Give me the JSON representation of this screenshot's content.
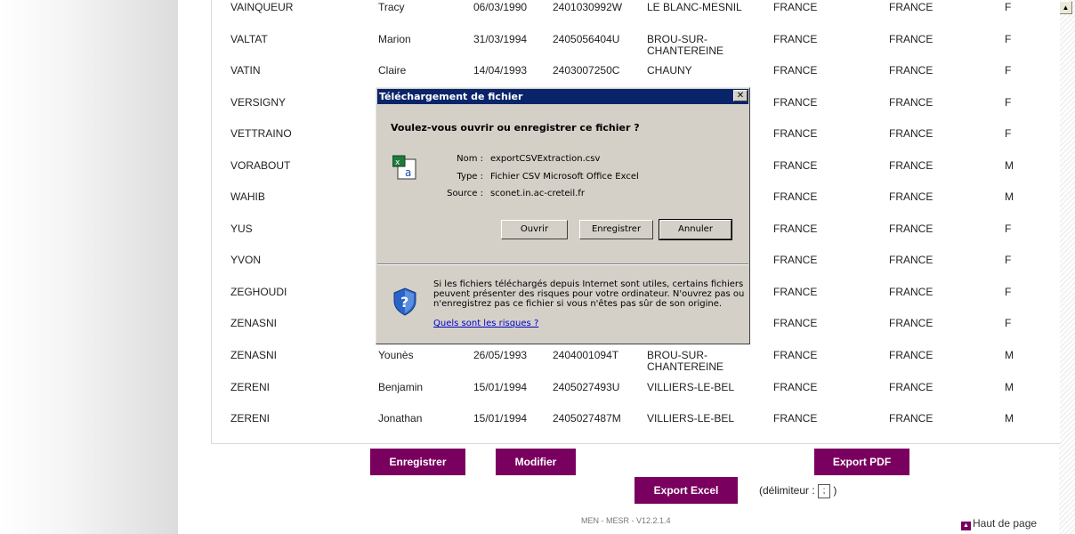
{
  "table": {
    "rows": [
      {
        "name": "VAINQUEUR",
        "first": "Tracy",
        "dob": "06/03/1990",
        "ine": "2401030992W",
        "city": "LE BLANC-MESNIL",
        "country1": "FRANCE",
        "country2": "FRANCE",
        "sex": "F"
      },
      {
        "name": "VALTAT",
        "first": "Marion",
        "dob": "31/03/1994",
        "ine": "2405056404U",
        "city": "BROU-SUR-CHANTEREINE",
        "country1": "FRANCE",
        "country2": "FRANCE",
        "sex": "F"
      },
      {
        "name": "VATIN",
        "first": "Claire",
        "dob": "14/04/1993",
        "ine": "2403007250C",
        "city": "CHAUNY",
        "country1": "FRANCE",
        "country2": "FRANCE",
        "sex": "F"
      },
      {
        "name": "VERSIGNY",
        "first": "",
        "dob": "",
        "ine": "",
        "city": "",
        "country1": "FRANCE",
        "country2": "FRANCE",
        "sex": "F"
      },
      {
        "name": "VETTRAINO",
        "first": "",
        "dob": "",
        "ine": "",
        "city": "",
        "country1": "FRANCE",
        "country2": "FRANCE",
        "sex": "F"
      },
      {
        "name": "VORABOUT",
        "first": "",
        "dob": "",
        "ine": "",
        "city": "",
        "country1": "FRANCE",
        "country2": "FRANCE",
        "sex": "M"
      },
      {
        "name": "WAHIB",
        "first": "",
        "dob": "",
        "ine": "",
        "city": "",
        "country1": "FRANCE",
        "country2": "FRANCE",
        "sex": "M"
      },
      {
        "name": "YUS",
        "first": "",
        "dob": "",
        "ine": "",
        "city": "",
        "country1": "FRANCE",
        "country2": "FRANCE",
        "sex": "F"
      },
      {
        "name": "YVON",
        "first": "",
        "dob": "",
        "ine": "",
        "city": "",
        "country1": "FRANCE",
        "country2": "FRANCE",
        "sex": "F"
      },
      {
        "name": "ZEGHOUDI",
        "first": "",
        "dob": "",
        "ine": "",
        "city": "",
        "country1": "FRANCE",
        "country2": "FRANCE",
        "sex": "F"
      },
      {
        "name": "ZENASNI",
        "first": "",
        "dob": "",
        "ine": "",
        "city": "",
        "country1": "FRANCE",
        "country2": "FRANCE",
        "sex": "F"
      },
      {
        "name": "ZENASNI",
        "first": "Younès",
        "dob": "26/05/1993",
        "ine": "2404001094T",
        "city": "BROU-SUR-CHANTEREINE",
        "country1": "FRANCE",
        "country2": "FRANCE",
        "sex": "M"
      },
      {
        "name": "ZERENI",
        "first": "Benjamin",
        "dob": "15/01/1994",
        "ine": "2405027493U",
        "city": "VILLIERS-LE-BEL",
        "country1": "FRANCE",
        "country2": "FRANCE",
        "sex": "M"
      },
      {
        "name": "ZERENI",
        "first": "Jonathan",
        "dob": "15/01/1994",
        "ine": "2405027487M",
        "city": "VILLIERS-LE-BEL",
        "country1": "FRANCE",
        "country2": "FRANCE",
        "sex": "M"
      }
    ]
  },
  "actions": {
    "save": "Enregistrer",
    "modify": "Modifier",
    "export_pdf": "Export PDF",
    "export_excel": "Export Excel",
    "delimiter_label": "(délimiteur :",
    "delimiter_value": ";",
    "delimiter_close": ")"
  },
  "footer": {
    "version": "MEN - MESR - V12.2.1.4",
    "top_link": "Haut de page"
  },
  "dialog": {
    "title": "Téléchargement de fichier",
    "question": "Voulez-vous ouvrir ou enregistrer ce fichier ?",
    "name_label": "Nom :",
    "name_value": "exportCSVExtraction.csv",
    "type_label": "Type :",
    "type_value": "Fichier CSV Microsoft Office Excel",
    "source_label": "Source :",
    "source_value": "sconet.in.ac-creteil.fr",
    "open": "Ouvrir",
    "save": "Enregistrer",
    "cancel": "Annuler",
    "warning": "Si les fichiers téléchargés depuis Internet sont utiles, certains fichiers peuvent présenter des risques pour votre ordinateur. N'ouvrez pas ou n'enregistrez pas ce fichier si vous n'êtes pas sûr de son origine.",
    "risk_link": "Quels sont les risques ?"
  },
  "colors": {
    "button_purple": "#7a005f",
    "dialog_title": "#0a246a",
    "dialog_bg": "#d4d0c8"
  }
}
